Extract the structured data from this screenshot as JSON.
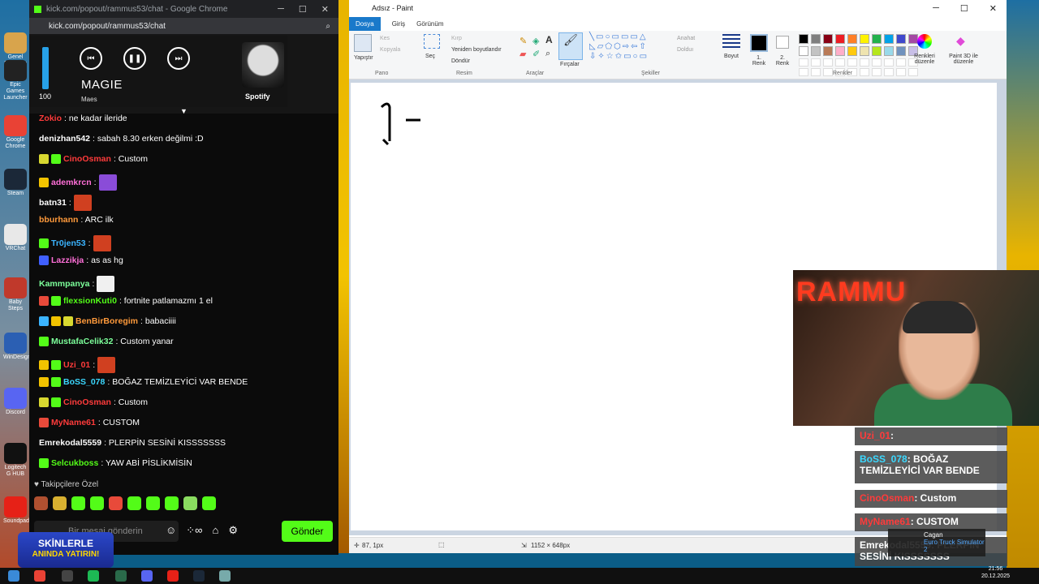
{
  "desktop": {
    "left_icons": [
      {
        "label": "Genel Dosyalar",
        "color": "#d8a44c"
      },
      {
        "label": "Epic Games Launcher",
        "color": "#222222"
      },
      {
        "label": "Google Chrome",
        "color": "#e94235"
      },
      {
        "label": "Steam",
        "color": "#1b2838"
      },
      {
        "label": "VRChat",
        "color": "#e8e8e8"
      },
      {
        "label": "Baby Steps",
        "color": "#c0392b"
      },
      {
        "label": "WinDesign",
        "color": "#2b5fb3"
      },
      {
        "label": "Discord",
        "color": "#5865f2"
      },
      {
        "label": "Logitech G HUB",
        "color": "#111111"
      },
      {
        "label": "Soundpad",
        "color": "#e62117"
      }
    ]
  },
  "chrome": {
    "title": "kick.com/popout/rammus53/chat - Google Chrome",
    "url": "kick.com/popout/rammus53/chat",
    "spotify": {
      "volume": 100,
      "volume_label": "100",
      "song": "MAGIE",
      "artist": "Maes",
      "brand": "Spotify"
    },
    "messages": [
      {
        "user": "Zokio",
        "text": ": ne kadar ileride",
        "color": "#ff3b3b",
        "badges": []
      },
      {
        "user": "denizhan542",
        "text": ": sabah 8.30 erken değilmi :D",
        "color": "#ffffff",
        "badges": []
      },
      {
        "user": "CinoOsman",
        "text": ": Custom",
        "color": "#ff3b3b",
        "badges": [
          "#d8d830",
          "#53fc18"
        ]
      },
      {
        "user": "ademkrcn",
        "text": ":",
        "color": "#ff6fd8",
        "badges": [
          "#f2c300"
        ],
        "emote": "#8a4cd8"
      },
      {
        "user": "batn31",
        "text": ":",
        "color": "#ffffff",
        "badges": [],
        "emote": "#d04020"
      },
      {
        "user": "bburhann",
        "text": ": ARC ilk",
        "color": "#ff9a3b",
        "badges": []
      },
      {
        "user": "Tr0jen53",
        "text": ":",
        "color": "#3bb4ff",
        "badges": [
          "#53fc18"
        ],
        "emote": "#d04020"
      },
      {
        "user": "Lazzikja",
        "text": ": as as hg",
        "color": "#ff6fd8",
        "badges": [
          "#4060ff"
        ]
      },
      {
        "user": "Kammpanya",
        "text": ":",
        "color": "#7cff9a",
        "badges": [],
        "emote": "#f0f0f0"
      },
      {
        "user": "flexsionKuti0",
        "text": ": fortnite patlamazmı 1 el",
        "color": "#53fc18",
        "badges": [
          "#e84a3a",
          "#53fc18"
        ]
      },
      {
        "user": "BenBirBoregim",
        "text": ": babaciiii",
        "color": "#ff9a3b",
        "badges": [
          "#3bb4ff",
          "#f2c300",
          "#d8d830"
        ]
      },
      {
        "user": "MustafaCelik32",
        "text": ": Custom yanar",
        "color": "#7cff9a",
        "badges": [
          "#53fc18"
        ]
      },
      {
        "user": "Uzi_01",
        "text": ":",
        "color": "#ff3b3b",
        "badges": [
          "#f2c300",
          "#53fc18"
        ],
        "emote": "#d04020"
      },
      {
        "user": "BoSS_078",
        "text": ": BOĞAZ TEMİZLEYİCİ VAR BENDE",
        "color": "#3bd8ff",
        "badges": [
          "#f2c300",
          "#53fc18"
        ]
      },
      {
        "user": "CinoOsman",
        "text": ": Custom",
        "color": "#ff3b3b",
        "badges": [
          "#d8d830",
          "#53fc18"
        ]
      },
      {
        "user": "MyName61",
        "text": ": CUSTOM",
        "color": "#ff3b3b",
        "badges": [
          "#e84a3a"
        ]
      },
      {
        "user": "Emrekodal5559",
        "text": ": PLERPİN SESİNİ KISSSSSSS",
        "color": "#ffffff",
        "badges": []
      },
      {
        "user": "Selcukboss",
        "text": ": YAW ABİ PİSLİKMİSİN",
        "color": "#53fc18",
        "badges": [
          "#53fc18"
        ]
      }
    ],
    "followers_label": "Takipçilere Özel",
    "input_placeholder": "Bir mesaj gönderin",
    "send_label": "Gönder"
  },
  "promo": {
    "line1": "SKİNLERLE",
    "line2": "ANINDA YATIRIN!"
  },
  "paint": {
    "title": "Adsız - Paint",
    "tabs": [
      "Dosya",
      "Giriş",
      "Görünüm"
    ],
    "ribbon": {
      "paste": "Yapıştır",
      "cut": "Kes",
      "copy": "Kopyala",
      "select": "Seç",
      "crop": "Kırp",
      "resize": "Yeniden boyutlandır",
      "rotate": "Döndür",
      "brushes": "Fırçalar",
      "outline": "Anahat",
      "fill": "Dolduı",
      "size": "Boyut",
      "color1": "1. Renk",
      "color2": "2. Renk",
      "edit_colors": "Renkleri düzenle",
      "paint3d": "Paint 3D ile düzenle",
      "groups": [
        "Pano",
        "Resim",
        "Araçlar",
        "Şekiller",
        "Renkler"
      ]
    },
    "palette": [
      "#000000",
      "#7f7f7f",
      "#880015",
      "#ed1c24",
      "#ff7f27",
      "#fff200",
      "#22b14c",
      "#00a2e8",
      "#3f48cc",
      "#a349a4",
      "#ffffff",
      "#c3c3c3",
      "#b97a57",
      "#ffaec9",
      "#ffc90e",
      "#efe4b0",
      "#b5e61d",
      "#99d9ea",
      "#7092be",
      "#c8bfe7"
    ],
    "status": {
      "cursor": "87, 1px",
      "size": "1152 × 648px"
    }
  },
  "overlay": [
    {
      "user": "Uzi_01",
      "text": ":",
      "color": "#ff3b3b"
    },
    {
      "user": "BoSS_078",
      "text": ": BOĞAZ TEMİZLEYİCİ VAR BENDE",
      "color": "#3bd8ff"
    },
    {
      "user": "CinoOsman",
      "text": ": Custom",
      "color": "#ff3b3b"
    },
    {
      "user": "MyName61",
      "text": ": CUSTOM",
      "color": "#ff3b3b"
    },
    {
      "user": "Emrekodal5559",
      "text": ": PLERPİN SESİNİ KISSSSSSS",
      "color": "#ffffff"
    }
  ],
  "notification": {
    "name": "Cagan",
    "subtitle": "Euro Truck Simulator 2"
  },
  "clock": {
    "time": "21:56",
    "date": "20.12.2025"
  }
}
